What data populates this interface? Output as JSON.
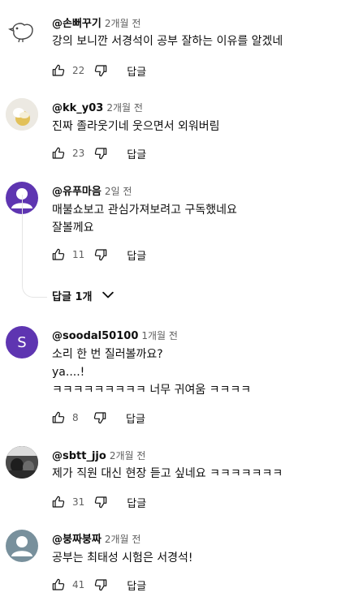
{
  "comments": [
    {
      "handle": "@손뻐꾸기",
      "time": "2개월 전",
      "lines": [
        "강의 보니깐 서경석이 공부 잘하는 이유를 알겠네"
      ],
      "likes": "22",
      "reply_label": "답글",
      "avatar": {
        "type": "bird-icon"
      }
    },
    {
      "handle": "@kk_y03",
      "time": "2개월 전",
      "lines": [
        "진짜 졸라웃기네 웃으면서 외워버림"
      ],
      "likes": "23",
      "reply_label": "답글",
      "avatar": {
        "type": "photo",
        "color": "#d9c27a"
      }
    },
    {
      "handle": "@유푸마음",
      "time": "2일 전",
      "lines": [
        "매불쇼보고 관심가져보려고 구독했네요",
        "잘볼께요"
      ],
      "likes": "11",
      "reply_label": "답글",
      "avatar": {
        "type": "person-icon",
        "color": "#5e35b1"
      }
    },
    {
      "handle": "@soodal50100",
      "time": "1개월 전",
      "lines": [
        "소리 한 번 질러볼까요?",
        "ya....!",
        "ㅋㅋㅋㅋㅋㅋㅋㅋㅋ 너무 귀여움 ㅋㅋㅋㅋ"
      ],
      "likes": "8",
      "reply_label": "답글",
      "avatar": {
        "type": "letter",
        "letter": "S",
        "color": "#5e35b1"
      }
    },
    {
      "handle": "@sbtt_jjo",
      "time": "2개월 전",
      "lines": [
        "제가 직원 대신 현장 듣고 싶네요 ㅋㅋㅋㅋㅋㅋㅋ"
      ],
      "likes": "31",
      "reply_label": "답글",
      "avatar": {
        "type": "photo",
        "color": "#3a3a3a"
      }
    },
    {
      "handle": "@붕짜붕짜",
      "time": "2개월 전",
      "lines": [
        "공부는 최태성 시험은 서경석!"
      ],
      "likes": "41",
      "reply_label": "답글",
      "avatar": {
        "type": "person-icon",
        "color": "#78909c"
      }
    }
  ],
  "replies_toggle": {
    "label": "답글 1개"
  }
}
